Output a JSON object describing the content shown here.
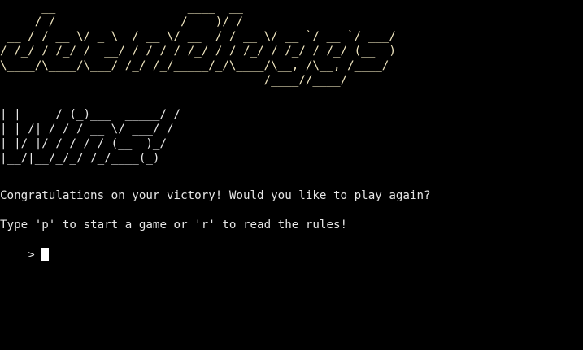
{
  "terminal": {
    "banner_title": [
      "      __                   ____  __",
      "     / /___  ___    ____  / __ )/ /___  ____ _____ ______",
      " __ / / __ \\/ _ \\  / __ \\/ __  / / __ \\/ __ `/ __ `/ ___/",
      "/ /_/ / /_/ /  __/ / / / / /_/ / / /_/ / /_/ / /_/ (__  )",
      "\\____/\\____/\\___/ /_/ /_/_____/_/\\____/\\__, /\\__, /____/",
      "                                      /____//____/"
    ],
    "banner_sub": [
      " _        ___         __",
      "| |     / (_)___  _____/ /",
      "| | /| / / / __ \\/ ___/ /",
      "| |/ |/ / / / / (__  )_/",
      "|__/|__/_/_/ /_/____(_)"
    ],
    "message": "Congratulations on your victory! Would you like to play again?",
    "instruction": "Type 'p' to start a game or 'r' to read the rules!",
    "prompt_symbol": "> ",
    "colors": {
      "background": "#000000",
      "text": "#e6e6e6",
      "cursor": "#ffffff"
    }
  }
}
